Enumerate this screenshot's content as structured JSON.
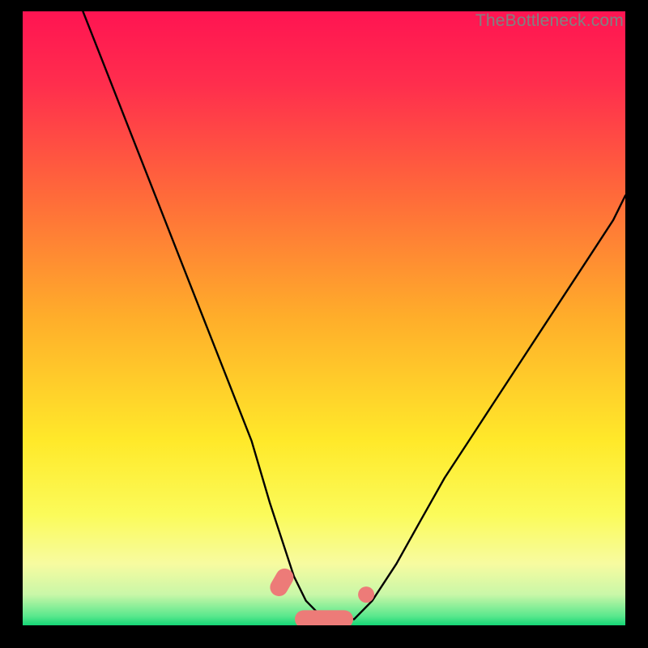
{
  "watermark": "TheBottleneck.com",
  "chart_data": {
    "type": "line",
    "title": "",
    "xlabel": "",
    "ylabel": "",
    "xlim": [
      0,
      100
    ],
    "ylim": [
      0,
      100
    ],
    "grid": false,
    "series": [
      {
        "name": "curve",
        "x": [
          10,
          14,
          18,
          22,
          26,
          30,
          34,
          38,
          41,
          43,
          45,
          47,
          50,
          53,
          55,
          58,
          62,
          66,
          70,
          74,
          78,
          82,
          86,
          90,
          94,
          98,
          100
        ],
        "y": [
          100,
          90,
          80,
          70,
          60,
          50,
          40,
          30,
          20,
          14,
          8,
          4,
          1,
          1,
          1,
          4,
          10,
          17,
          24,
          30,
          36,
          42,
          48,
          54,
          60,
          66,
          70
        ]
      }
    ],
    "annotations": [
      {
        "name": "marker-left-dash",
        "shape": "pill",
        "x": 43,
        "y": 7
      },
      {
        "name": "marker-bottom-pill",
        "shape": "pill",
        "x": 50,
        "y": 1
      },
      {
        "name": "marker-right-dot",
        "shape": "dot",
        "x": 57,
        "y": 5
      }
    ],
    "background_gradient": {
      "stops": [
        {
          "pos": 0.0,
          "color": "#ff1452"
        },
        {
          "pos": 0.12,
          "color": "#ff2e4d"
        },
        {
          "pos": 0.3,
          "color": "#ff6a3a"
        },
        {
          "pos": 0.5,
          "color": "#ffae2a"
        },
        {
          "pos": 0.7,
          "color": "#ffe92a"
        },
        {
          "pos": 0.82,
          "color": "#fbfb5a"
        },
        {
          "pos": 0.9,
          "color": "#f7fba0"
        },
        {
          "pos": 0.95,
          "color": "#c9f7a8"
        },
        {
          "pos": 0.985,
          "color": "#5ae88d"
        },
        {
          "pos": 1.0,
          "color": "#15d676"
        }
      ]
    },
    "marker_color": "#ed7b78"
  }
}
